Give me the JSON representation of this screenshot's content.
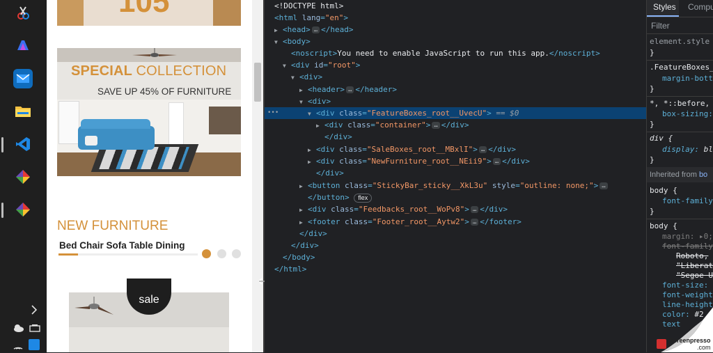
{
  "webpage": {
    "hero_price": "105",
    "special_title_1": "SPECIAL",
    "special_title_2": "COLLECTION",
    "special_subtitle": "SAVE UP 45% OF FURNITURE",
    "section_title": "NEW FURNITURE",
    "product_title": "Bed Chair Sofa Table Dining",
    "sale_badge": "sale"
  },
  "devtools": {
    "elements": {
      "doctype": "<!DOCTYPE html>",
      "html_lang": "\"en\"",
      "noscript_text": "You need to enable JavaScript to run this app.",
      "root_id": "\"root\"",
      "featureboxes_class": "\"FeatureBoxes_root__UvecU\"",
      "selected_suffix": "== $0",
      "container_class": "\"container\"",
      "saleboxes_class": "\"SaleBoxes_root__MBxlI\"",
      "newfurniture_class": "\"NewFurniture_root__NEii9\"",
      "stickybar_class": "\"StickyBar_sticky__XkL3u\"",
      "stickybar_style": "\"outline: none;\"",
      "flex_badge": "flex",
      "feedbacks_class": "\"Feedbacks_root__WoPv8\"",
      "footer_class": "\"Footer_root__Aytw2\""
    },
    "styles": {
      "tab_styles": "Styles",
      "tab_computed": "Compu",
      "filter_placeholder": "Filter",
      "rule1_selector": "element.style",
      "rule2_selector": ".FeatureBoxes_",
      "rule2_prop": "margin-botto",
      "rule3_selector": "*, *::before,",
      "rule3_prop": "box-sizing:",
      "rule4_selector": "div {",
      "rule4_prop": "display:",
      "rule4_val": "bl",
      "inherited_label": "Inherited from",
      "inherited_from": "bo",
      "rule5_selector": "body {",
      "rule5_prop": "font-family",
      "rule6_selector": "body {",
      "rule6_margin": "margin:",
      "rule6_margin_val": "0;",
      "rule6_ff": "font-family",
      "rule6_ff_v1": "Roboto,",
      "rule6_ff_v2": "\"Liberat",
      "rule6_ff_v3": "\"Segoe U",
      "rule6_fs": "font-size:",
      "rule6_fw": "font-weight",
      "rule6_lh": "line-height",
      "rule6_color": "color:",
      "rule6_color_val": "#2",
      "rule6_text": "text",
      "close_brace": "}"
    }
  },
  "watermark": {
    "brand": "Screenpresso",
    "domain": ".com"
  },
  "colors": {
    "accent": "#d4913a",
    "sofa": "#3d8fc4",
    "selection": "#0b4273",
    "tag": "#5db0d7",
    "value": "#f29766"
  }
}
